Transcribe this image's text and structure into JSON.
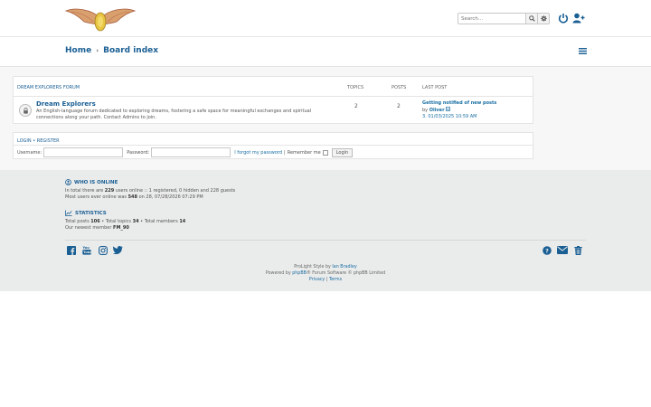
{
  "header": {
    "search_placeholder": "Search…",
    "icons": [
      "search-icon",
      "gear-icon",
      "power-icon",
      "register-user-icon"
    ]
  },
  "breadcrumb": {
    "home": "Home",
    "separator": "›",
    "board": "Board index"
  },
  "forum": {
    "category": "DREAM EXPLORERS FORUM",
    "col_topics": "TOPICS",
    "col_posts": "POSTS",
    "col_last": "LAST POST",
    "row": {
      "title": "Dream Explorers",
      "description": "An English-language forum dedicated to exploring dreams, fostering a safe space for meaningful exchanges and spiritual connections along your path. Contact Admins to join.",
      "topics": "2",
      "posts": "2",
      "last_title": "Getting notified of new posts",
      "last_by": "by",
      "last_author": "Oliver",
      "last_date": "3. 01/03/2025 10:59 AM"
    }
  },
  "login": {
    "login_link": "LOGIN",
    "bullet": "•",
    "register_link": "REGISTER",
    "username_label": "Username:",
    "password_label": "Password:",
    "forgot": "I forgot my password",
    "pipe": "|",
    "remember": "Remember me",
    "button": "Login"
  },
  "online": {
    "heading": "WHO IS ONLINE",
    "line1_a": "In total there are ",
    "line1_count": "229",
    "line1_b": " users online :: 1 registered, 0 hidden and 228 guests",
    "line2_a": "Most users ever online was ",
    "line2_count": "548",
    "line2_b": " on 28, 07/28/2026 07:29 PM"
  },
  "stats": {
    "heading": "STATISTICS",
    "posts_label": "Total posts ",
    "posts": "106",
    "topics_label": " • Total topics ",
    "topics": "34",
    "members_label": " • Total members ",
    "members": "14",
    "newest_label": "Our newest member ",
    "newest": "FM_90"
  },
  "social": [
    "facebook-icon",
    "youtube-icon",
    "instagram-icon",
    "twitter-icon"
  ],
  "footer_icons": [
    "help-icon",
    "envelope-icon",
    "trash-icon"
  ],
  "credits": {
    "style_a": "ProLight Style by ",
    "style_author": "Ian Bradley",
    "powered_a": "Powered by ",
    "powered_link": "phpBB",
    "powered_b": "® Forum Software © phpBB Limited",
    "privacy": "Privacy",
    "sep": " | ",
    "terms": "Terms"
  },
  "colors": {
    "accent": "#1a5f94",
    "link": "#1a6fa3",
    "footer_bg": "#eaebeb"
  }
}
